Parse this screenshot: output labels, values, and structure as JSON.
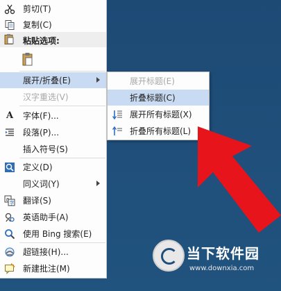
{
  "context_menu": {
    "cut": "剪切(T)",
    "copy": "复制(C)",
    "paste_options": "粘贴选项:",
    "expand_collapse": "展开/折叠(E)",
    "han_reconvert": "汉字重选(V)",
    "font": "字体(F)...",
    "paragraph": "段落(P)...",
    "insert_symbol": "插入符号(S)",
    "define": "定义(D)",
    "synonyms": "同义词(Y)",
    "translate": "翻译(S)",
    "english_assistant": "英语助手(A)",
    "bing_search": "使用 Bing 搜索(E)",
    "hyperlink": "超链接(H)...",
    "new_comment": "新建批注(M)"
  },
  "submenu": {
    "expand_heading": "展开标题(E)",
    "collapse_heading": "折叠标题(C)",
    "expand_all_headings": "展开所有标题(X)",
    "collapse_all_headings": "折叠所有标题(L)"
  },
  "colors": {
    "background": "#1f4e79",
    "highlight": "#c9dbf2",
    "arrow": "#e8141c"
  },
  "watermark": {
    "name": "当下软件园",
    "url": "www.downxia.com"
  }
}
